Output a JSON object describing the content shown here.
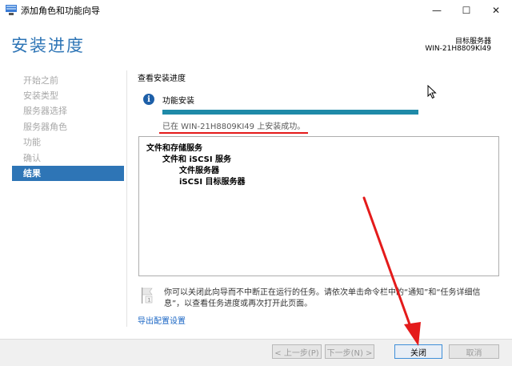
{
  "window": {
    "title": "添加角色和功能向导",
    "minimize_glyph": "—",
    "maximize_glyph": "☐",
    "close_glyph": "✕"
  },
  "header": {
    "title": "安装进度",
    "destination_label": "目标服务器",
    "destination_value": "WIN-21H8809KI49"
  },
  "nav": {
    "items": [
      {
        "label": "开始之前",
        "active": false
      },
      {
        "label": "安装类型",
        "active": false
      },
      {
        "label": "服务器选择",
        "active": false
      },
      {
        "label": "服务器角色",
        "active": false
      },
      {
        "label": "功能",
        "active": false
      },
      {
        "label": "确认",
        "active": false
      },
      {
        "label": "结果",
        "active": true
      }
    ]
  },
  "main": {
    "section_label": "查看安装进度",
    "feature_title": "功能安装",
    "progress_fraction": 1.0,
    "status_text": "已在 WIN-21H8809KI49 上安装成功。",
    "results": [
      {
        "text": "文件和存储服务",
        "level": 0
      },
      {
        "text": "文件和 iSCSI 服务",
        "level": 1
      },
      {
        "text": "文件服务器",
        "level": 2
      },
      {
        "text": "iSCSI 目标服务器",
        "level": 2
      }
    ],
    "note": "你可以关闭此向导而不中断正在运行的任务。请依次单击命令栏中的“通知”和“任务详细信息”，以查看任务进度或再次打开此页面。",
    "export_link": "导出配置设置"
  },
  "footer": {
    "prev": "< 上一步(P)",
    "next": "下一步(N) >",
    "close": "关闭",
    "cancel": "取消"
  },
  "colors": {
    "accent": "#2e75b6",
    "progress": "#1f8aa8",
    "annotation": "#e41b1b",
    "link": "#1a66c4"
  },
  "icons": {
    "app": "server-manager-icon",
    "info": "info-icon",
    "flag": "flag-icon",
    "cursor": "mouse-cursor-icon"
  }
}
